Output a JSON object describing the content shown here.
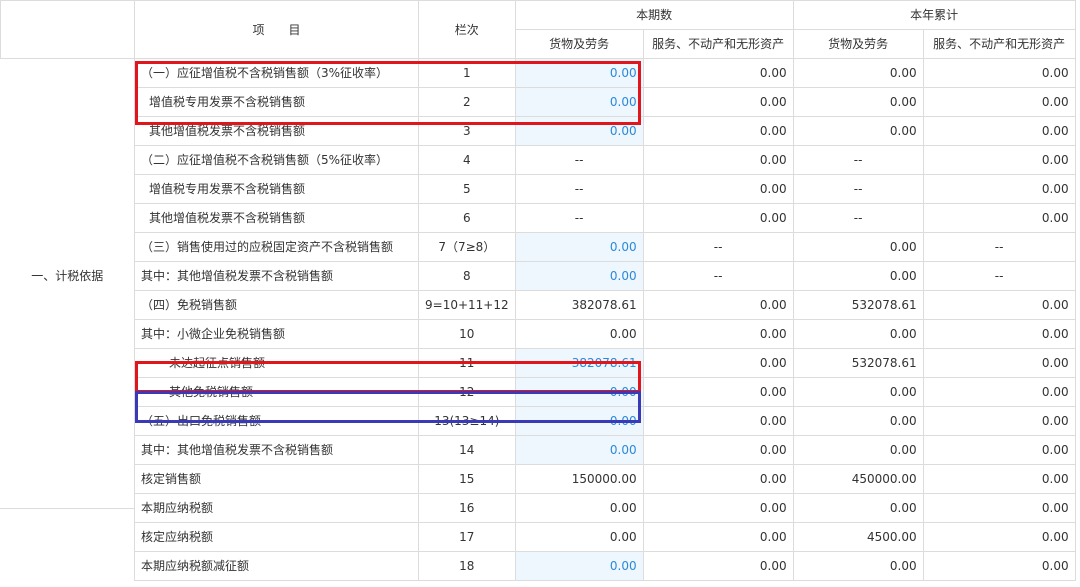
{
  "header": {
    "item": "项　　目",
    "column_no": "栏次",
    "current_period": "本期数",
    "year_cumulative": "本年累计",
    "goods": "货物及劳务",
    "services": "服务、不动产和无形资产"
  },
  "category": {
    "tax_basis": "一、计税依据"
  },
  "rows": [
    {
      "item": "（一）应征增值税不含税销售额（3%征收率）",
      "col": "1",
      "a": "0.00",
      "b": "0.00",
      "c": "0.00",
      "d": "0.00"
    },
    {
      "item": "增值税专用发票不含税销售额",
      "col": "2",
      "a": "0.00",
      "b": "0.00",
      "c": "0.00",
      "d": "0.00"
    },
    {
      "item": "其他增值税发票不含税销售额",
      "col": "3",
      "a": "0.00",
      "b": "0.00",
      "c": "0.00",
      "d": "0.00"
    },
    {
      "item": "（二）应征增值税不含税销售额（5%征收率）",
      "col": "4",
      "a": "--",
      "b": "0.00",
      "c": "--",
      "d": "0.00"
    },
    {
      "item": "增值税专用发票不含税销售额",
      "col": "5",
      "a": "--",
      "b": "0.00",
      "c": "--",
      "d": "0.00"
    },
    {
      "item": "其他增值税发票不含税销售额",
      "col": "6",
      "a": "--",
      "b": "0.00",
      "c": "--",
      "d": "0.00"
    },
    {
      "item": "（三）销售使用过的应税固定资产不含税销售额",
      "col": "7（7≥8）",
      "a": "0.00",
      "b": "--",
      "c": "0.00",
      "d": "--"
    },
    {
      "item": "其中：其他增值税发票不含税销售额",
      "col": "8",
      "a": "0.00",
      "b": "--",
      "c": "0.00",
      "d": "--"
    },
    {
      "item": "（四）免税销售额",
      "col": "9=10+11+12",
      "a": "382078.61",
      "b": "0.00",
      "c": "532078.61",
      "d": "0.00"
    },
    {
      "item": "其中：小微企业免税销售额",
      "col": "10",
      "a": "0.00",
      "b": "0.00",
      "c": "0.00",
      "d": "0.00"
    },
    {
      "item": "未达起征点销售额",
      "col": "11",
      "a": "382078.61",
      "b": "0.00",
      "c": "532078.61",
      "d": "0.00"
    },
    {
      "item": "其他免税销售额",
      "col": "12",
      "a": "0.00",
      "b": "0.00",
      "c": "0.00",
      "d": "0.00"
    },
    {
      "item": "（五）出口免税销售额",
      "col": "13(13≥14)",
      "a": "0.00",
      "b": "0.00",
      "c": "0.00",
      "d": "0.00"
    },
    {
      "item": "其中：其他增值税发票不含税销售额",
      "col": "14",
      "a": "0.00",
      "b": "0.00",
      "c": "0.00",
      "d": "0.00"
    },
    {
      "item": "核定销售额",
      "col": "15",
      "a": "150000.00",
      "b": "0.00",
      "c": "450000.00",
      "d": "0.00"
    },
    {
      "item": "本期应纳税额",
      "col": "16",
      "a": "0.00",
      "b": "0.00",
      "c": "0.00",
      "d": "0.00"
    },
    {
      "item": "核定应纳税额",
      "col": "17",
      "a": "0.00",
      "b": "0.00",
      "c": "4500.00",
      "d": "0.00"
    },
    {
      "item": "本期应纳税额减征额",
      "col": "18",
      "a": "0.00",
      "b": "0.00",
      "c": "0.00",
      "d": "0.00"
    }
  ],
  "colors": {
    "input_bg": "#eef6fe",
    "input_text": "#2a8ad8",
    "highlight_red": "#e0161c",
    "highlight_blue": "#3a3ab8"
  }
}
